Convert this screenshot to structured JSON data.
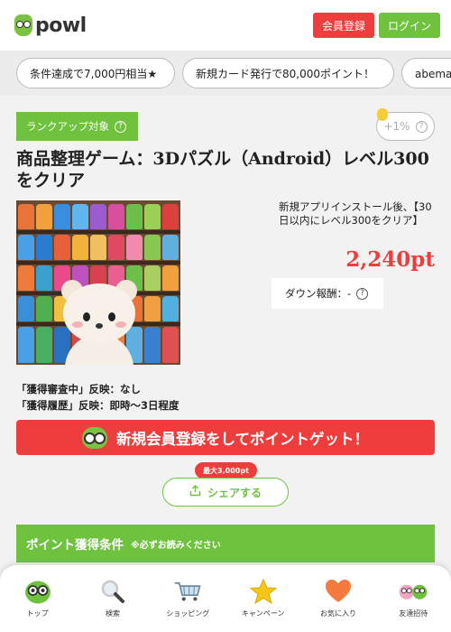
{
  "header": {
    "logo_text": "POWL",
    "register_label": "会員登録",
    "login_label": "ログイン"
  },
  "tags": [
    "条件達成で7,000円相当★",
    "新規カード発行で80,000ポイント！",
    "abemaプ"
  ],
  "offer": {
    "rank_badge": "ランクアップ対象",
    "rank_help": "?",
    "rate_text": "+1%",
    "rate_help": "?",
    "title": "商品整理ゲーム：3Dパズル（Android）レベル300をクリア",
    "description": "新規アプリインストール後、【30日以内にレベル300をクリア】",
    "points": "2,240pt",
    "down_reward": "ダウン報酬：-",
    "down_help": "?",
    "reflect_pending": "「獲得審査中」反映：なし",
    "reflect_history": "「獲得履歴」反映：即時～3日程度"
  },
  "cta": {
    "label": "新規会員登録をしてポイントゲット！"
  },
  "share": {
    "max_badge": "最大3,000pt",
    "label": "シェアする"
  },
  "conditions": {
    "title": "ポイント獲得条件",
    "note": "※必ずお読みください"
  },
  "bottom_nav": [
    {
      "label": "トップ",
      "icon": "owl-icon"
    },
    {
      "label": "検索",
      "icon": "magnifier-icon"
    },
    {
      "label": "ショッピング",
      "icon": "cart-icon"
    },
    {
      "label": "キャンペーン",
      "icon": "star-icon"
    },
    {
      "label": "お気に入り",
      "icon": "heart-icon"
    },
    {
      "label": "友達招待",
      "icon": "friends-icon"
    }
  ],
  "colors": {
    "brand_green": "#6fc23e",
    "accent_red": "#ee3d3d"
  }
}
